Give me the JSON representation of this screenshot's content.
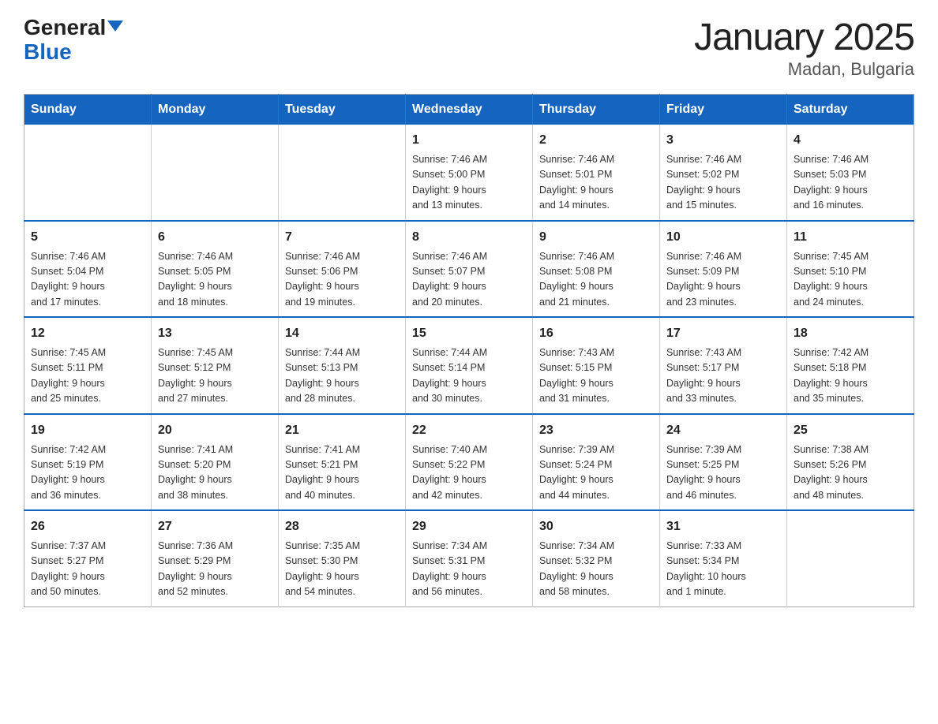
{
  "logo": {
    "general": "General",
    "blue": "Blue"
  },
  "title": "January 2025",
  "subtitle": "Madan, Bulgaria",
  "weekdays": [
    "Sunday",
    "Monday",
    "Tuesday",
    "Wednesday",
    "Thursday",
    "Friday",
    "Saturday"
  ],
  "weeks": [
    [
      {
        "day": "",
        "info": ""
      },
      {
        "day": "",
        "info": ""
      },
      {
        "day": "",
        "info": ""
      },
      {
        "day": "1",
        "info": "Sunrise: 7:46 AM\nSunset: 5:00 PM\nDaylight: 9 hours\nand 13 minutes."
      },
      {
        "day": "2",
        "info": "Sunrise: 7:46 AM\nSunset: 5:01 PM\nDaylight: 9 hours\nand 14 minutes."
      },
      {
        "day": "3",
        "info": "Sunrise: 7:46 AM\nSunset: 5:02 PM\nDaylight: 9 hours\nand 15 minutes."
      },
      {
        "day": "4",
        "info": "Sunrise: 7:46 AM\nSunset: 5:03 PM\nDaylight: 9 hours\nand 16 minutes."
      }
    ],
    [
      {
        "day": "5",
        "info": "Sunrise: 7:46 AM\nSunset: 5:04 PM\nDaylight: 9 hours\nand 17 minutes."
      },
      {
        "day": "6",
        "info": "Sunrise: 7:46 AM\nSunset: 5:05 PM\nDaylight: 9 hours\nand 18 minutes."
      },
      {
        "day": "7",
        "info": "Sunrise: 7:46 AM\nSunset: 5:06 PM\nDaylight: 9 hours\nand 19 minutes."
      },
      {
        "day": "8",
        "info": "Sunrise: 7:46 AM\nSunset: 5:07 PM\nDaylight: 9 hours\nand 20 minutes."
      },
      {
        "day": "9",
        "info": "Sunrise: 7:46 AM\nSunset: 5:08 PM\nDaylight: 9 hours\nand 21 minutes."
      },
      {
        "day": "10",
        "info": "Sunrise: 7:46 AM\nSunset: 5:09 PM\nDaylight: 9 hours\nand 23 minutes."
      },
      {
        "day": "11",
        "info": "Sunrise: 7:45 AM\nSunset: 5:10 PM\nDaylight: 9 hours\nand 24 minutes."
      }
    ],
    [
      {
        "day": "12",
        "info": "Sunrise: 7:45 AM\nSunset: 5:11 PM\nDaylight: 9 hours\nand 25 minutes."
      },
      {
        "day": "13",
        "info": "Sunrise: 7:45 AM\nSunset: 5:12 PM\nDaylight: 9 hours\nand 27 minutes."
      },
      {
        "day": "14",
        "info": "Sunrise: 7:44 AM\nSunset: 5:13 PM\nDaylight: 9 hours\nand 28 minutes."
      },
      {
        "day": "15",
        "info": "Sunrise: 7:44 AM\nSunset: 5:14 PM\nDaylight: 9 hours\nand 30 minutes."
      },
      {
        "day": "16",
        "info": "Sunrise: 7:43 AM\nSunset: 5:15 PM\nDaylight: 9 hours\nand 31 minutes."
      },
      {
        "day": "17",
        "info": "Sunrise: 7:43 AM\nSunset: 5:17 PM\nDaylight: 9 hours\nand 33 minutes."
      },
      {
        "day": "18",
        "info": "Sunrise: 7:42 AM\nSunset: 5:18 PM\nDaylight: 9 hours\nand 35 minutes."
      }
    ],
    [
      {
        "day": "19",
        "info": "Sunrise: 7:42 AM\nSunset: 5:19 PM\nDaylight: 9 hours\nand 36 minutes."
      },
      {
        "day": "20",
        "info": "Sunrise: 7:41 AM\nSunset: 5:20 PM\nDaylight: 9 hours\nand 38 minutes."
      },
      {
        "day": "21",
        "info": "Sunrise: 7:41 AM\nSunset: 5:21 PM\nDaylight: 9 hours\nand 40 minutes."
      },
      {
        "day": "22",
        "info": "Sunrise: 7:40 AM\nSunset: 5:22 PM\nDaylight: 9 hours\nand 42 minutes."
      },
      {
        "day": "23",
        "info": "Sunrise: 7:39 AM\nSunset: 5:24 PM\nDaylight: 9 hours\nand 44 minutes."
      },
      {
        "day": "24",
        "info": "Sunrise: 7:39 AM\nSunset: 5:25 PM\nDaylight: 9 hours\nand 46 minutes."
      },
      {
        "day": "25",
        "info": "Sunrise: 7:38 AM\nSunset: 5:26 PM\nDaylight: 9 hours\nand 48 minutes."
      }
    ],
    [
      {
        "day": "26",
        "info": "Sunrise: 7:37 AM\nSunset: 5:27 PM\nDaylight: 9 hours\nand 50 minutes."
      },
      {
        "day": "27",
        "info": "Sunrise: 7:36 AM\nSunset: 5:29 PM\nDaylight: 9 hours\nand 52 minutes."
      },
      {
        "day": "28",
        "info": "Sunrise: 7:35 AM\nSunset: 5:30 PM\nDaylight: 9 hours\nand 54 minutes."
      },
      {
        "day": "29",
        "info": "Sunrise: 7:34 AM\nSunset: 5:31 PM\nDaylight: 9 hours\nand 56 minutes."
      },
      {
        "day": "30",
        "info": "Sunrise: 7:34 AM\nSunset: 5:32 PM\nDaylight: 9 hours\nand 58 minutes."
      },
      {
        "day": "31",
        "info": "Sunrise: 7:33 AM\nSunset: 5:34 PM\nDaylight: 10 hours\nand 1 minute."
      },
      {
        "day": "",
        "info": ""
      }
    ]
  ]
}
